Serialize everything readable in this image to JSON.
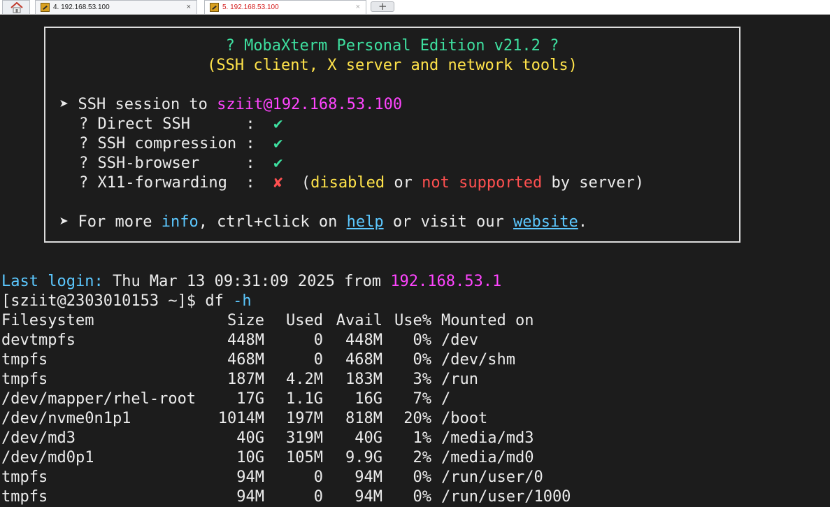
{
  "tabs": [
    {
      "label": "4. 192.168.53.100",
      "close": "×"
    },
    {
      "label": "5. 192.168.53.100",
      "close": "×"
    }
  ],
  "banner": {
    "title": "? MobaXterm Personal Edition v21.2 ?",
    "subtitle": "(SSH client, X server and network tools)",
    "session_prefix": "➤ SSH session to ",
    "session_target": "sziit@192.168.53.100",
    "checks": [
      {
        "label": "? Direct SSH      :  ",
        "mark": "✔"
      },
      {
        "label": "? SSH compression :  ",
        "mark": "✔"
      },
      {
        "label": "? SSH-browser     :  ",
        "mark": "✔"
      }
    ],
    "x11_label": "? X11-forwarding  :  ",
    "x11_mark": "✘",
    "x11_open": "  (",
    "x11_disabled": "disabled",
    "x11_or": " or ",
    "x11_not_supported": "not supported",
    "x11_by_server": " by server)",
    "info_prefix": "➤ For more ",
    "info_word": "info",
    "info_mid": ", ctrl+click on ",
    "help_word": "help",
    "info_mid2": " or visit our ",
    "website_word": "website",
    "info_end": "."
  },
  "terminal": {
    "last_login_label": "Last login:",
    "last_login_text": " Thu Mar 13 09:31:09 2025 from ",
    "last_login_ip": "192.168.53.1",
    "prompt": "[sziit@2303010153 ~]$ df ",
    "prompt_flag": "-h",
    "df_header": [
      "Filesystem",
      "Size",
      "Used",
      "Avail",
      "Use%",
      "Mounted on"
    ],
    "df_rows": [
      [
        "devtmpfs",
        "448M",
        "0",
        "448M",
        "0%",
        "/dev"
      ],
      [
        "tmpfs",
        "468M",
        "0",
        "468M",
        "0%",
        "/dev/shm"
      ],
      [
        "tmpfs",
        "187M",
        "4.2M",
        "183M",
        "3%",
        "/run"
      ],
      [
        "/dev/mapper/rhel-root",
        "17G",
        "1.1G",
        "16G",
        "7%",
        "/"
      ],
      [
        "/dev/nvme0n1p1",
        "1014M",
        "197M",
        "818M",
        "20%",
        "/boot"
      ],
      [
        "/dev/md3",
        "40G",
        "319M",
        "40G",
        "1%",
        "/media/md3"
      ],
      [
        "/dev/md0p1",
        "10G",
        "105M",
        "9.9G",
        "2%",
        "/media/md0"
      ],
      [
        "tmpfs",
        "94M",
        "0",
        "94M",
        "0%",
        "/run/user/0"
      ],
      [
        "tmpfs",
        "94M",
        "0",
        "94M",
        "0%",
        "/run/user/1000"
      ]
    ]
  }
}
